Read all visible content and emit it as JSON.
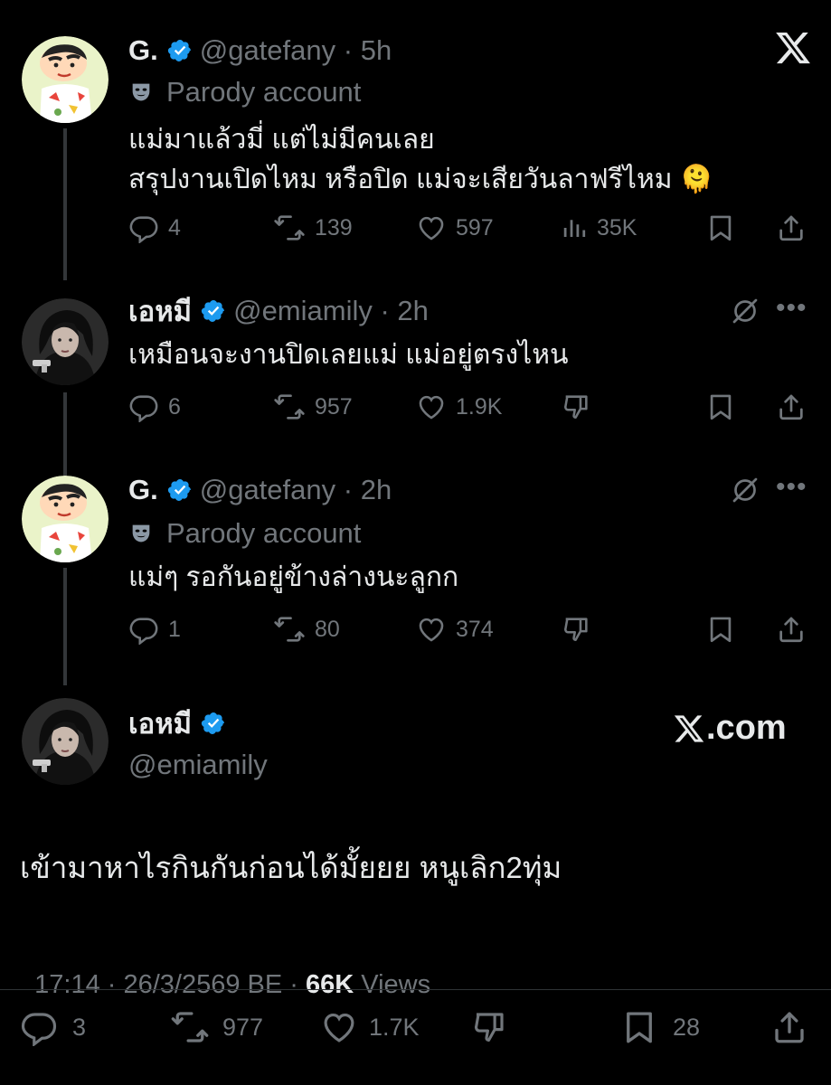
{
  "close_icon": "x-logo-icon",
  "tweets": [
    {
      "name": "G.",
      "handle": "@gatefany",
      "time": "5h",
      "parody_label": "Parody account",
      "text_line1": "แม่มาแล้วมี่ แต่ไม่มีคนเลย",
      "text_line2": "สรุปงานเปิดไหม หรือปิด แม่จะเสียวันลาฟรีไหม",
      "emoji": "🫠",
      "replies": "4",
      "reposts": "139",
      "likes": "597",
      "views": "35K"
    },
    {
      "name": "เอหมี",
      "handle": "@emiamily",
      "time": "2h",
      "text_line1": "เหมือนจะงานปิดเลยแม่ แม่อยู่ตรงไหน",
      "replies": "6",
      "reposts": "957",
      "likes": "1.9K"
    },
    {
      "name": "G.",
      "handle": "@gatefany",
      "time": "2h",
      "parody_label": "Parody account",
      "text_line1": "แม่ๆ รอกันอยู่ข้างล่างนะลูกก",
      "replies": "1",
      "reposts": "80",
      "likes": "374"
    }
  ],
  "main_tweet": {
    "name": "เอหมี",
    "handle": "@emiamily",
    "brand": "X.com",
    "text": "เข้ามาหาไรกินกันก่อนได้มั้ยยย หนูเลิก2ทุ่ม",
    "timestamp": "17:14 · 26/3/2569 BE · ",
    "views_count": "66K",
    "views_label": " Views",
    "replies": "3",
    "reposts": "977",
    "likes": "1.7K",
    "bookmarks": "28"
  },
  "colors": {
    "background": "#000000",
    "text": "#e7e9ea",
    "muted": "#71767b",
    "verified": "#1d9bf0"
  }
}
